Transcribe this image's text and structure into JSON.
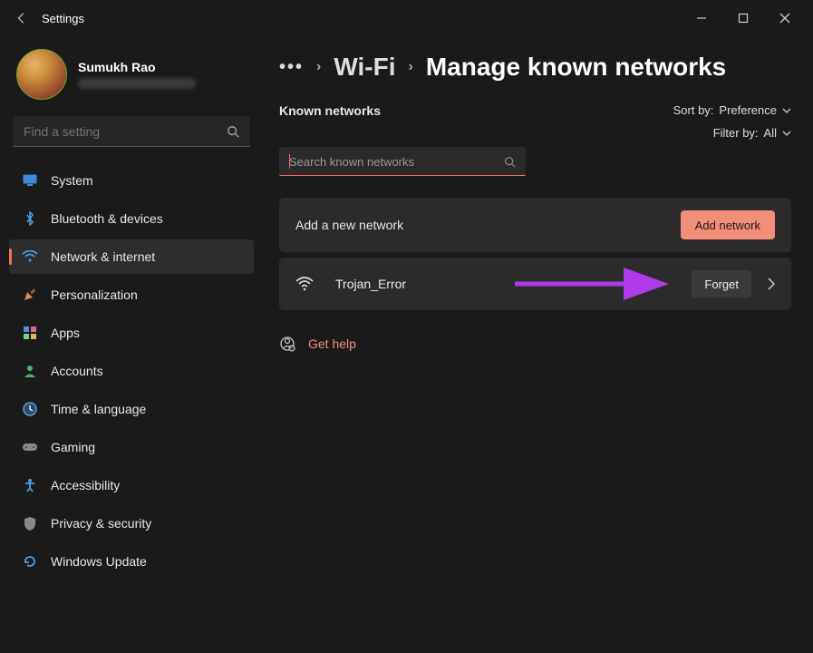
{
  "titlebar": {
    "title": "Settings"
  },
  "profile": {
    "name": "Sumukh Rao"
  },
  "search": {
    "placeholder": "Find a setting"
  },
  "nav": {
    "system": "System",
    "bluetooth": "Bluetooth & devices",
    "network": "Network & internet",
    "personalization": "Personalization",
    "apps": "Apps",
    "accounts": "Accounts",
    "time": "Time & language",
    "gaming": "Gaming",
    "accessibility": "Accessibility",
    "privacy": "Privacy & security",
    "update": "Windows Update"
  },
  "breadcrumb": {
    "wifi": "Wi-Fi",
    "current": "Manage known networks"
  },
  "known": {
    "label": "Known networks",
    "sort_label": "Sort by:",
    "sort_value": "Preference",
    "filter_label": "Filter by:",
    "filter_value": "All",
    "search_placeholder": "Search known networks"
  },
  "add_card": {
    "text": "Add a new network",
    "button": "Add network"
  },
  "network": {
    "name": "Trojan_Error",
    "forget": "Forget"
  },
  "help": {
    "link": "Get help"
  }
}
